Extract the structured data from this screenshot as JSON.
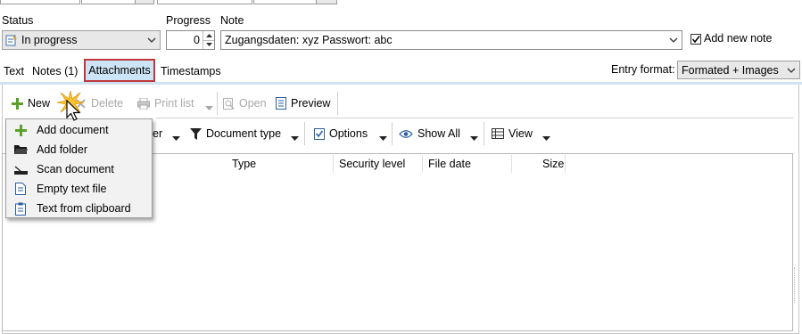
{
  "status": {
    "label": "Status",
    "value": "In progress"
  },
  "progress": {
    "label": "Progress",
    "value": "0"
  },
  "note": {
    "label": "Note",
    "value": "Zugangsdaten: xyz Passwort: abc"
  },
  "add_new_note": {
    "label": "Add new note",
    "checked": true
  },
  "tabs": [
    {
      "label": "Text"
    },
    {
      "label": "Notes (1)"
    },
    {
      "label": "Attachments",
      "active": true
    },
    {
      "label": "Timestamps"
    }
  ],
  "entry_format": {
    "label": "Entry format:",
    "value": "Formated + Images"
  },
  "toolbar1": {
    "new": "New",
    "delete": "Delete",
    "print_list": "Print list",
    "open": "Open",
    "preview": "Preview"
  },
  "toolbar2": {
    "filter_partial": "er",
    "document_type": "Document type",
    "options": "Options",
    "show_all": "Show All",
    "view": "View"
  },
  "columns": [
    "Type",
    "Security level",
    "File date",
    "Size"
  ],
  "new_menu": [
    {
      "label": "Add document",
      "icon": "plus-icon"
    },
    {
      "label": "Add folder",
      "icon": "folder-icon"
    },
    {
      "label": "Scan document",
      "icon": "scanner-icon"
    },
    {
      "label": "Empty text file",
      "icon": "text-file-icon"
    },
    {
      "label": "Text from clipboard",
      "icon": "clipboard-icon"
    }
  ],
  "colors": {
    "accent": "#cce4f7",
    "highlight_border": "#c0363c",
    "plus": "#5aa02c"
  }
}
